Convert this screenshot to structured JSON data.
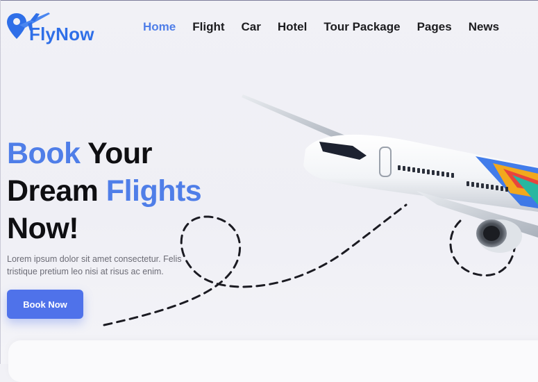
{
  "brand": {
    "name": "FlyNow"
  },
  "nav": [
    {
      "label": "Home",
      "active": true
    },
    {
      "label": "Flight",
      "active": false
    },
    {
      "label": "Car",
      "active": false
    },
    {
      "label": "Hotel",
      "active": false
    },
    {
      "label": "Tour Package",
      "active": false
    },
    {
      "label": "Pages",
      "active": false
    },
    {
      "label": "News",
      "active": false
    }
  ],
  "hero": {
    "title_part1": "Book",
    "title_part2": " Your",
    "title_part3": "Dream ",
    "title_part4": "Flights",
    "title_part5": "Now!",
    "description": "Lorem ipsum dolor sit amet consectetur. Felis tristique pretium leo nisi at risus ac enim.",
    "cta_label": "Book Now"
  },
  "colors": {
    "accent": "#4f7ee8",
    "button": "#4f72ea",
    "text": "#0f0f12"
  }
}
